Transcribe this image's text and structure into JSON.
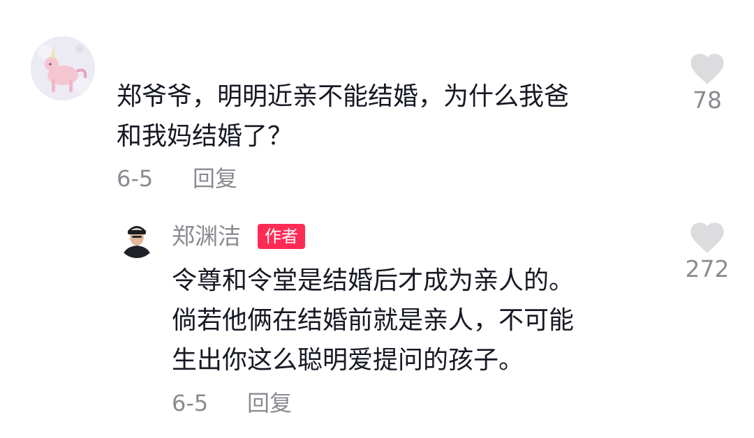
{
  "comment": {
    "text": "郑爷爷，明明近亲不能结婚，为什么我爸\n和我妈结婚了？",
    "date": "6-5",
    "reply_label": "回复",
    "likes": "78"
  },
  "reply": {
    "author": "郑渊洁",
    "badge": "作者",
    "text": "令尊和令堂是结婚后才成为亲人的。\n倘若他俩在结婚前就是亲人，不可能\n生出你这么聪明爱提问的孩子。",
    "date": "6-5",
    "reply_label": "回复",
    "likes": "272"
  },
  "colors": {
    "text": "#161823",
    "meta": "#8a8b91",
    "heart": "#dcdcde",
    "badge": "#fe2c55"
  },
  "icons": {
    "like": "heart-icon"
  }
}
